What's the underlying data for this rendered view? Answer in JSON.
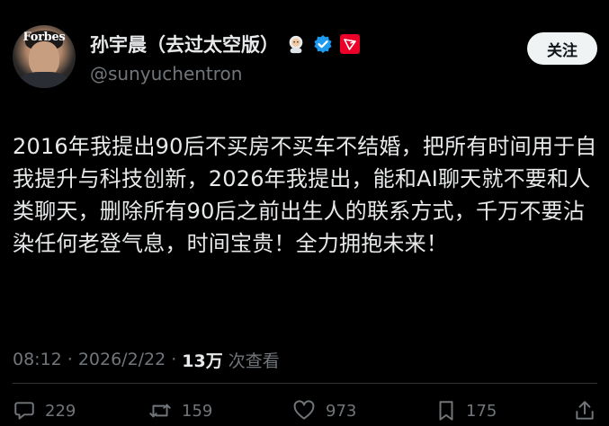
{
  "author": {
    "avatar_brand": "Forbes",
    "display_name": "孙宇晨（去过太空版）",
    "handle": "@sunyuchentron",
    "badges": [
      "astronaut-emoji",
      "verified-badge",
      "tron-logo"
    ]
  },
  "follow_button": "关注",
  "tweet": {
    "text": "2016年我提出90后不买房不买车不结婚，把所有时间用于自我提升与科技创新，2026年我提出，能和AI聊天就不要和人类聊天，删除所有90后之前出生人的联系方式，千万不要沾染任何老登气息，时间宝贵！全力拥抱未来！"
  },
  "meta": {
    "time": "08:12",
    "separator": "·",
    "date": "2026/2/22",
    "views_count": "13万",
    "views_label": "次查看"
  },
  "actions": {
    "reply_count": "229",
    "retweet_count": "159",
    "like_count": "973",
    "bookmark_count": "175"
  },
  "colors": {
    "background": "#000000",
    "text": "#e7e9ea",
    "muted": "#71767b",
    "verified": "#1d9bf0",
    "tron": "#eb0029",
    "button_bg": "#eff3f4"
  }
}
